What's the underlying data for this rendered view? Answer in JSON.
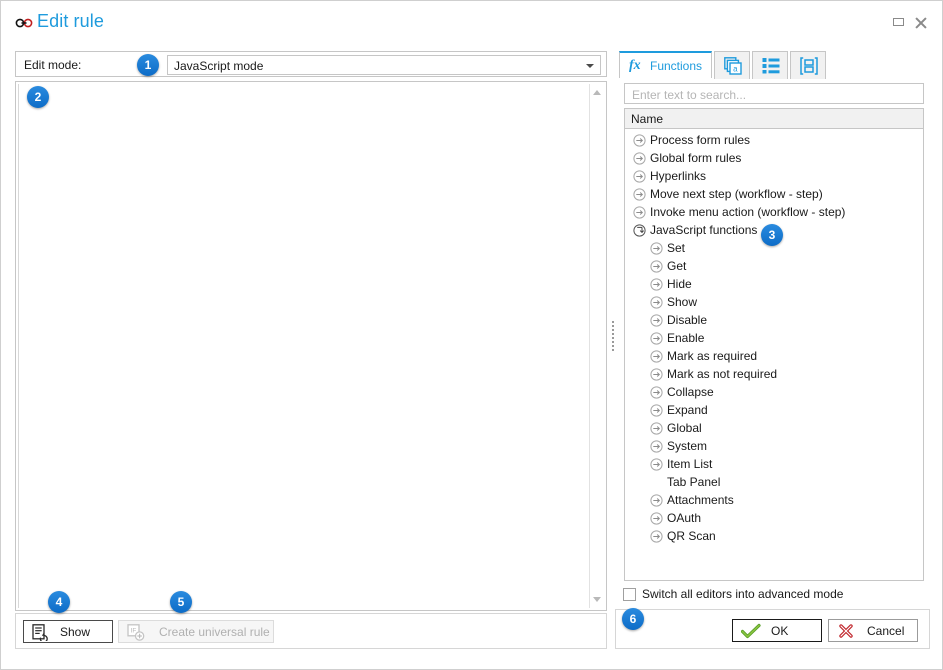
{
  "window": {
    "title": "Edit rule",
    "title_icon": "link-chain-icon",
    "maximize_label": "Maximize",
    "close_label": "Close",
    "accent_color": "#1e9bdd",
    "badge_color": "#1277d4"
  },
  "left": {
    "mode_label": "Edit mode:",
    "mode_value": "JavaScript mode",
    "editor_value": ""
  },
  "right": {
    "tabs": [
      {
        "label": "Functions",
        "icon": "fx-icon",
        "active": true
      },
      {
        "label": "",
        "icon": "pages-a-icon",
        "active": false
      },
      {
        "label": "",
        "icon": "list-items-icon",
        "active": false
      },
      {
        "label": "",
        "icon": "boxed-panel-icon",
        "active": false
      }
    ],
    "search_placeholder": "Enter text to search...",
    "search_value": "",
    "grid_header": "Name",
    "tree": [
      {
        "label": "Process form rules",
        "depth": 0,
        "icon": "arrow-right-circle-icon"
      },
      {
        "label": "Global form rules",
        "depth": 0,
        "icon": "arrow-right-circle-icon"
      },
      {
        "label": "Hyperlinks",
        "depth": 0,
        "icon": "arrow-right-circle-icon"
      },
      {
        "label": "Move next step (workflow - step)",
        "depth": 0,
        "icon": "arrow-right-circle-icon"
      },
      {
        "label": "Invoke menu action (workflow - step)",
        "depth": 0,
        "icon": "arrow-right-circle-icon"
      },
      {
        "label": "JavaScript functions",
        "depth": 0,
        "icon": "arrow-down-right-circle-icon"
      },
      {
        "label": "Set",
        "depth": 1,
        "icon": "arrow-right-circle-icon"
      },
      {
        "label": "Get",
        "depth": 1,
        "icon": "arrow-right-circle-icon"
      },
      {
        "label": "Hide",
        "depth": 1,
        "icon": "arrow-right-circle-icon"
      },
      {
        "label": "Show",
        "depth": 1,
        "icon": "arrow-right-circle-icon"
      },
      {
        "label": "Disable",
        "depth": 1,
        "icon": "arrow-right-circle-icon"
      },
      {
        "label": "Enable",
        "depth": 1,
        "icon": "arrow-right-circle-icon"
      },
      {
        "label": "Mark as required",
        "depth": 1,
        "icon": "arrow-right-circle-icon"
      },
      {
        "label": "Mark as not required",
        "depth": 1,
        "icon": "arrow-right-circle-icon"
      },
      {
        "label": "Collapse",
        "depth": 1,
        "icon": "arrow-right-circle-icon"
      },
      {
        "label": "Expand",
        "depth": 1,
        "icon": "arrow-right-circle-icon"
      },
      {
        "label": "Global",
        "depth": 1,
        "icon": "arrow-right-circle-icon"
      },
      {
        "label": "System",
        "depth": 1,
        "icon": "arrow-right-circle-icon"
      },
      {
        "label": "Item List",
        "depth": 1,
        "icon": "arrow-right-circle-icon"
      },
      {
        "label": "Tab Panel",
        "depth": 1,
        "icon": "none"
      },
      {
        "label": "Attachments",
        "depth": 1,
        "icon": "arrow-right-circle-icon"
      },
      {
        "label": "OAuth",
        "depth": 1,
        "icon": "arrow-right-circle-icon"
      },
      {
        "label": "QR Scan",
        "depth": 1,
        "icon": "arrow-right-circle-icon"
      }
    ],
    "advanced_checkbox_label": "Switch all editors into advanced mode",
    "advanced_checkbox_checked": false
  },
  "footer": {
    "show_label": "Show",
    "show_icon": "document-refresh-icon",
    "universal_label": "Create universal rule",
    "universal_icon": "if-add-icon",
    "universal_disabled": true,
    "ok_label": "OK",
    "ok_icon": "green-check-icon",
    "cancel_label": "Cancel",
    "cancel_icon": "red-cross-icon"
  },
  "callouts": [
    {
      "number": "1",
      "target": "edit-mode-combo"
    },
    {
      "number": "2",
      "target": "script-editor"
    },
    {
      "number": "3",
      "target": "javascript-functions-node"
    },
    {
      "number": "4",
      "target": "show-button"
    },
    {
      "number": "5",
      "target": "create-universal-rule-button"
    },
    {
      "number": "6",
      "target": "ok-cancel-bar"
    }
  ]
}
